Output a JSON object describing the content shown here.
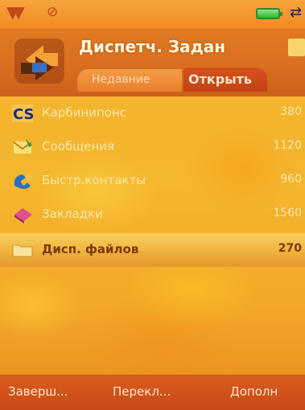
{
  "app": {
    "title": "Диспетч. Задан"
  },
  "tabs": [
    {
      "label": "Недавние"
    },
    {
      "label": "Открыть"
    }
  ],
  "items": [
    {
      "label": "Карбинипонс",
      "size": "380",
      "icon": "cs-icon"
    },
    {
      "label": "Сообщения",
      "size": "1120",
      "icon": "messages-icon"
    },
    {
      "label": "Быстр.контакты",
      "size": "960",
      "icon": "contacts-icon"
    },
    {
      "label": "Закладки",
      "size": "1560",
      "icon": "bookmarks-icon"
    },
    {
      "label": "Дисп. файлов",
      "size": "270",
      "icon": "folder-icon",
      "selected": true
    }
  ],
  "softkeys": {
    "left": "Заверш...",
    "middle": "Перекл...",
    "right": "Дополн"
  },
  "colors": {
    "header": "#d86f1e",
    "background": "#f3b62f",
    "softkeys": "#d85c1e",
    "active_tab": "#c34214"
  }
}
